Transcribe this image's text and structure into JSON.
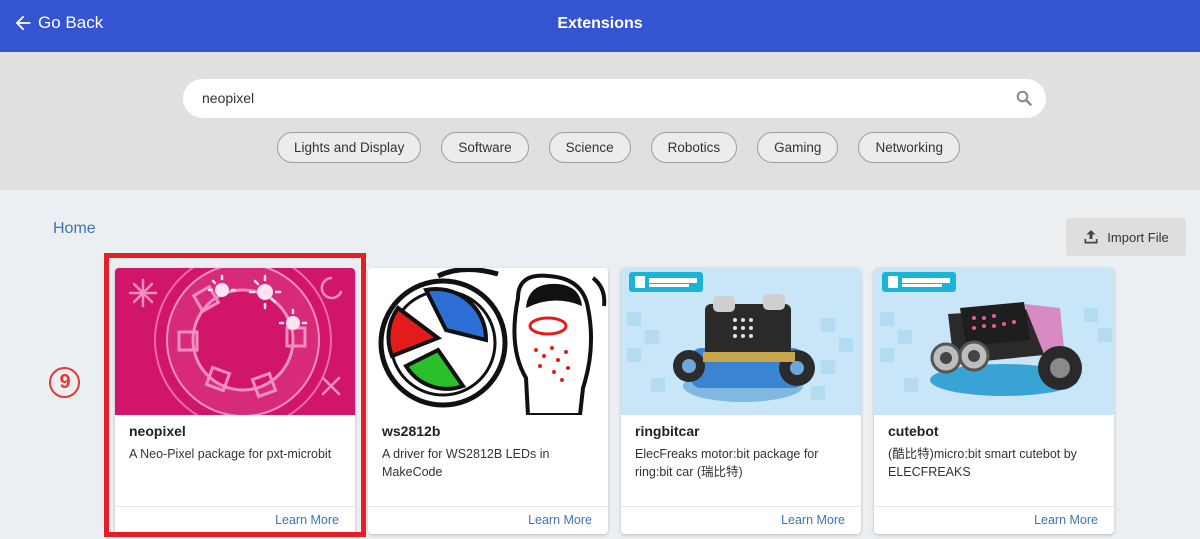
{
  "header": {
    "back_label": "Go Back",
    "title": "Extensions"
  },
  "search": {
    "value": "neopixel",
    "icon": "search-icon"
  },
  "categories": [
    "Lights and Display",
    "Software",
    "Science",
    "Robotics",
    "Gaming",
    "Networking"
  ],
  "breadcrumb": {
    "home": "Home"
  },
  "import": {
    "label": "Import File",
    "icon": "upload-icon"
  },
  "marker": {
    "label": "9"
  },
  "cards": [
    {
      "name": "neopixel",
      "description": "A Neo-Pixel package for pxt-microbit",
      "link": "Learn More",
      "highlighted": true
    },
    {
      "name": "ws2812b",
      "description": "A driver for WS2812B LEDs in MakeCode",
      "link": "Learn More"
    },
    {
      "name": "ringbitcar",
      "description": "ElecFreaks motor:bit package for ring:bit car (瑞比特)",
      "link": "Learn More"
    },
    {
      "name": "cutebot",
      "description": "(酷比特)micro:bit smart cutebot by ELECFREAKS",
      "link": "Learn More"
    }
  ],
  "colors": {
    "header_bg": "#3454d1",
    "highlight": "#e31e24",
    "link": "#3d74b5",
    "neopixel_bg": "#d0156a"
  }
}
